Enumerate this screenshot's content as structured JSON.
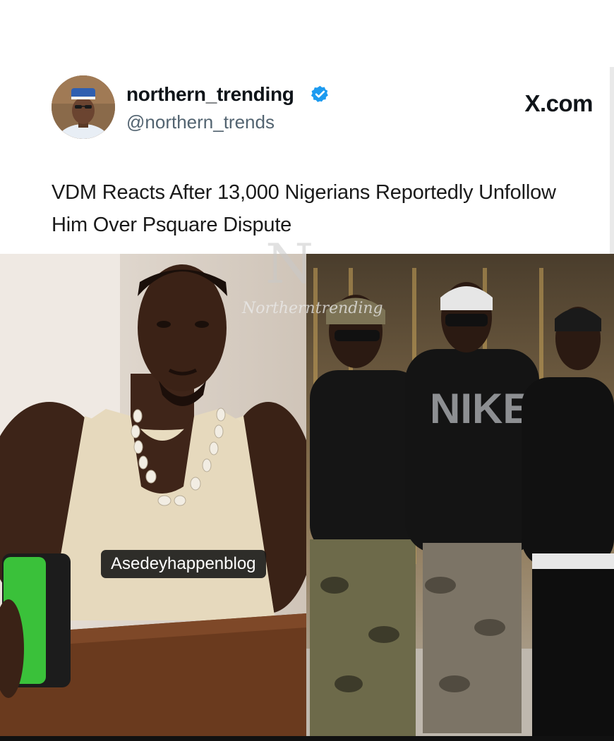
{
  "post": {
    "display_name": "northern_trending",
    "handle": "@northern_trends",
    "source": "X.com",
    "headline": "VDM Reacts After 13,000 Nigerians Reportedly Unfollow Him Over Psquare Dispute"
  },
  "icons": {
    "verified": "verified-badge-icon",
    "avatar": "profile-avatar"
  },
  "watermark": {
    "letter": "N",
    "text": "Northerntrending"
  },
  "caption": {
    "text": "Asedeyhappenblog"
  },
  "colors": {
    "verified_blue": "#1d9bf0",
    "handle_gray": "#536471",
    "text_dark": "#0f1419"
  }
}
